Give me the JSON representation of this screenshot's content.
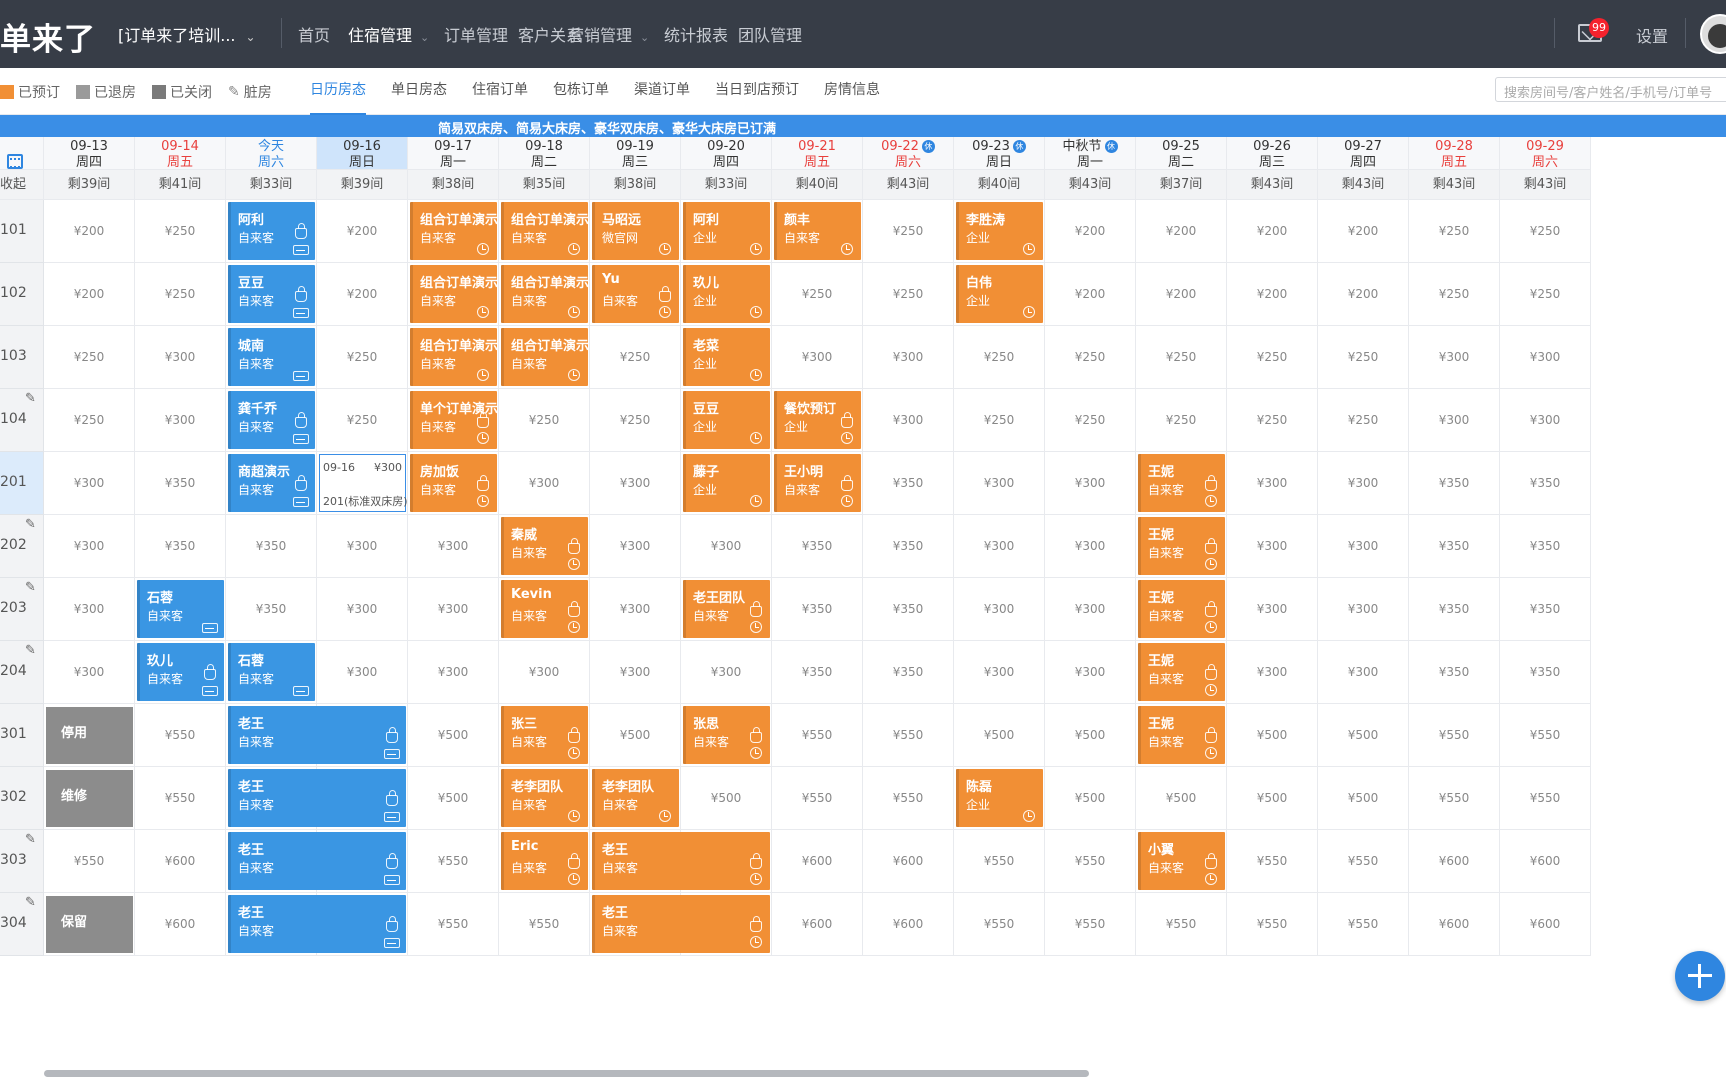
{
  "topbar": {
    "logo": "单来了",
    "store": "[订单来了培训...",
    "nav": [
      {
        "label": "首页",
        "active": false,
        "dropdown": false
      },
      {
        "label": "住宿管理",
        "active": true,
        "dropdown": true
      },
      {
        "label": "订单管理",
        "active": false,
        "dropdown": false
      },
      {
        "label": "客户关系",
        "active": false,
        "dropdown": false
      },
      {
        "label": "营销管理",
        "active": false,
        "dropdown": true
      },
      {
        "label": "统计报表",
        "active": false,
        "dropdown": false
      },
      {
        "label": "团队管理",
        "active": false,
        "dropdown": false
      }
    ],
    "mail_badge": "99",
    "settings": "设置"
  },
  "legend": [
    {
      "label": "已预订",
      "color": "#f18f35",
      "icon": "swatch"
    },
    {
      "label": "已退房",
      "color": "#9a9a9a",
      "icon": "swatch"
    },
    {
      "label": "已关闭",
      "color": "#7a7a7a",
      "icon": "swatch"
    },
    {
      "label": "脏房",
      "color": "",
      "icon": "broom-icon"
    }
  ],
  "tabs": [
    "日历房态",
    "单日房态",
    "住宿订单",
    "包栋订单",
    "渠道订单",
    "当日到店预订",
    "房情信息"
  ],
  "active_tab": 0,
  "search": {
    "placeholder": "搜索房间号/客户姓名/手机号/订单号"
  },
  "notice": "简易双床房、简易大床房、豪华双床房、豪华大床房已订满",
  "colors": {
    "booked": "#f18f35",
    "checked_in": "#3a96e3",
    "accent": "#2f86e0",
    "closed": "#8c8c8c"
  },
  "dates": [
    {
      "date": "09-13",
      "weekday": "周四",
      "type": "normal",
      "holiday": false
    },
    {
      "date": "09-14",
      "weekday": "周五",
      "type": "weekend",
      "holiday": false
    },
    {
      "date": "今天",
      "weekday": "周六",
      "type": "today",
      "holiday": false
    },
    {
      "date": "09-16",
      "weekday": "周日",
      "type": "selected",
      "holiday": false
    },
    {
      "date": "09-17",
      "weekday": "周一",
      "type": "normal",
      "holiday": false
    },
    {
      "date": "09-18",
      "weekday": "周二",
      "type": "normal",
      "holiday": false
    },
    {
      "date": "09-19",
      "weekday": "周三",
      "type": "normal",
      "holiday": false
    },
    {
      "date": "09-20",
      "weekday": "周四",
      "type": "normal",
      "holiday": false
    },
    {
      "date": "09-21",
      "weekday": "周五",
      "type": "weekend",
      "holiday": false
    },
    {
      "date": "09-22",
      "weekday": "周六",
      "type": "weekend",
      "holiday": true
    },
    {
      "date": "09-23",
      "weekday": "周日",
      "type": "normal",
      "holiday": true
    },
    {
      "date": "中秋节",
      "weekday": "周一",
      "type": "normal",
      "holiday": true
    },
    {
      "date": "09-25",
      "weekday": "周二",
      "type": "normal",
      "holiday": false
    },
    {
      "date": "09-26",
      "weekday": "周三",
      "type": "normal",
      "holiday": false
    },
    {
      "date": "09-27",
      "weekday": "周四",
      "type": "normal",
      "holiday": false
    },
    {
      "date": "09-28",
      "weekday": "周五",
      "type": "weekend",
      "holiday": false
    },
    {
      "date": "09-29",
      "weekday": "周六",
      "type": "weekend",
      "holiday": false
    }
  ],
  "holiday_badge": "休",
  "remaining_label": "收起",
  "remaining": [
    "剩39间",
    "剩41间",
    "剩33间",
    "剩39间",
    "剩38间",
    "剩35间",
    "剩38间",
    "剩33间",
    "剩40间",
    "剩43间",
    "剩40间",
    "剩43间",
    "剩37间",
    "剩43间",
    "剩43间",
    "剩43间",
    "剩43间"
  ],
  "rooms": [
    {
      "num": "101",
      "dirty": false,
      "prices": [
        "¥200",
        "¥250",
        "",
        "¥200",
        "",
        "",
        "",
        "",
        "",
        "¥250",
        "",
        "¥200",
        "¥200",
        "¥200",
        "¥200",
        "¥250",
        "¥250"
      ]
    },
    {
      "num": "102",
      "dirty": false,
      "prices": [
        "¥200",
        "¥250",
        "",
        "¥200",
        "",
        "",
        "",
        "",
        "¥250",
        "¥250",
        "",
        "¥200",
        "¥200",
        "¥200",
        "¥200",
        "¥250",
        "¥250"
      ]
    },
    {
      "num": "103",
      "dirty": false,
      "prices": [
        "¥250",
        "¥300",
        "",
        "¥250",
        "",
        "",
        "¥250",
        "",
        "¥300",
        "¥300",
        "¥250",
        "¥250",
        "¥250",
        "¥250",
        "¥250",
        "¥300",
        "¥300"
      ]
    },
    {
      "num": "104",
      "dirty": true,
      "prices": [
        "¥250",
        "¥300",
        "",
        "¥250",
        "",
        "¥250",
        "¥250",
        "",
        "",
        "¥300",
        "¥250",
        "¥250",
        "¥250",
        "¥250",
        "¥250",
        "¥300",
        "¥300"
      ]
    },
    {
      "num": "201",
      "dirty": false,
      "prices": [
        "¥300",
        "¥350",
        "",
        "",
        "",
        "¥300",
        "¥300",
        "",
        "",
        "¥350",
        "¥300",
        "¥300",
        "",
        "¥300",
        "¥300",
        "¥350",
        "¥350"
      ]
    },
    {
      "num": "202",
      "dirty": true,
      "prices": [
        "¥300",
        "¥350",
        "¥350",
        "¥300",
        "¥300",
        "",
        "¥300",
        "¥300",
        "¥350",
        "¥350",
        "¥300",
        "¥300",
        "",
        "¥300",
        "¥300",
        "¥350",
        "¥350"
      ]
    },
    {
      "num": "203",
      "dirty": true,
      "prices": [
        "¥300",
        "",
        "¥350",
        "¥300",
        "¥300",
        "",
        "¥300",
        "",
        "¥350",
        "¥350",
        "¥300",
        "¥300",
        "",
        "¥300",
        "¥300",
        "¥350",
        "¥350"
      ]
    },
    {
      "num": "204",
      "dirty": true,
      "prices": [
        "¥300",
        "",
        "",
        "¥300",
        "¥300",
        "¥300",
        "¥300",
        "¥300",
        "¥350",
        "¥350",
        "¥300",
        "¥300",
        "",
        "¥300",
        "¥300",
        "¥350",
        "¥350"
      ]
    },
    {
      "num": "301",
      "dirty": false,
      "prices": [
        "",
        "¥550",
        "",
        "",
        "¥500",
        "",
        "¥500",
        "",
        "¥550",
        "¥550",
        "¥500",
        "¥500",
        "",
        "¥500",
        "¥500",
        "¥550",
        "¥550"
      ]
    },
    {
      "num": "302",
      "dirty": false,
      "prices": [
        "",
        "¥550",
        "",
        "",
        "¥500",
        "",
        "",
        "¥500",
        "¥550",
        "¥550",
        "",
        "¥500",
        "¥500",
        "¥500",
        "¥500",
        "¥550",
        "¥550"
      ]
    },
    {
      "num": "303",
      "dirty": true,
      "prices": [
        "¥550",
        "¥600",
        "",
        "",
        "¥550",
        "",
        "",
        "",
        "¥600",
        "¥600",
        "¥550",
        "¥550",
        "",
        "¥550",
        "¥550",
        "¥600",
        "¥600"
      ]
    },
    {
      "num": "304",
      "dirty": true,
      "prices": [
        "",
        "¥600",
        "",
        "",
        "¥550",
        "¥550",
        "",
        "",
        "¥600",
        "¥600",
        "¥550",
        "¥550",
        "¥550",
        "¥550",
        "¥550",
        "¥600",
        "¥600"
      ]
    }
  ],
  "bookings": [
    {
      "room": 0,
      "col": 2,
      "span": 1,
      "name": "阿利",
      "source": "自来客",
      "color": "blue",
      "icons": [
        "lock",
        "bed"
      ]
    },
    {
      "room": 0,
      "col": 4,
      "span": 1,
      "name": "组合订单演示",
      "source": "自来客",
      "color": "orange",
      "icons": [
        "clock"
      ]
    },
    {
      "room": 0,
      "col": 5,
      "span": 1,
      "name": "组合订单演示",
      "source": "自来客",
      "color": "orange",
      "icons": [
        "clock"
      ]
    },
    {
      "room": 0,
      "col": 6,
      "span": 1,
      "name": "马昭远",
      "source": "微官网",
      "color": "orange",
      "icons": [
        "clock"
      ]
    },
    {
      "room": 0,
      "col": 7,
      "span": 1,
      "name": "阿利",
      "source": "企业",
      "color": "orange",
      "icons": [
        "clock"
      ]
    },
    {
      "room": 0,
      "col": 8,
      "span": 1,
      "name": "颜丰",
      "source": "自来客",
      "color": "orange",
      "icons": [
        "clock"
      ]
    },
    {
      "room": 0,
      "col": 10,
      "span": 1,
      "name": "李胜涛",
      "source": "企业",
      "color": "orange",
      "icons": [
        "clock"
      ]
    },
    {
      "room": 1,
      "col": 2,
      "span": 1,
      "name": "豆豆",
      "source": "自来客",
      "color": "blue",
      "icons": [
        "lock",
        "bed"
      ]
    },
    {
      "room": 1,
      "col": 4,
      "span": 1,
      "name": "组合订单演示",
      "source": "自来客",
      "color": "orange",
      "icons": [
        "clock"
      ]
    },
    {
      "room": 1,
      "col": 5,
      "span": 1,
      "name": "组合订单演示",
      "source": "自来客",
      "color": "orange",
      "icons": [
        "clock"
      ]
    },
    {
      "room": 1,
      "col": 6,
      "span": 1,
      "name": "Yu",
      "source": "自来客",
      "color": "orange",
      "icons": [
        "lock",
        "clock"
      ]
    },
    {
      "room": 1,
      "col": 7,
      "span": 1,
      "name": "玖儿",
      "source": "企业",
      "color": "orange",
      "icons": [
        "clock"
      ]
    },
    {
      "room": 1,
      "col": 10,
      "span": 1,
      "name": "白伟",
      "source": "企业",
      "color": "orange",
      "icons": [
        "clock"
      ]
    },
    {
      "room": 2,
      "col": 2,
      "span": 1,
      "name": "城南",
      "source": "自来客",
      "color": "blue",
      "icons": [
        "bed"
      ]
    },
    {
      "room": 2,
      "col": 4,
      "span": 1,
      "name": "组合订单演示",
      "source": "自来客",
      "color": "orange",
      "icons": [
        "clock"
      ]
    },
    {
      "room": 2,
      "col": 5,
      "span": 1,
      "name": "组合订单演示",
      "source": "自来客",
      "color": "orange",
      "icons": [
        "clock"
      ]
    },
    {
      "room": 2,
      "col": 7,
      "span": 1,
      "name": "老菜",
      "source": "企业",
      "color": "orange",
      "icons": [
        "clock"
      ]
    },
    {
      "room": 3,
      "col": 2,
      "span": 1,
      "name": "龚千乔",
      "source": "自来客",
      "color": "blue",
      "icons": [
        "lock",
        "bed"
      ]
    },
    {
      "room": 3,
      "col": 4,
      "span": 1,
      "name": "单个订单演示",
      "source": "自来客",
      "color": "orange",
      "icons": [
        "lock",
        "clock"
      ]
    },
    {
      "room": 3,
      "col": 7,
      "span": 1,
      "name": "豆豆",
      "source": "企业",
      "color": "orange",
      "icons": [
        "clock"
      ]
    },
    {
      "room": 3,
      "col": 8,
      "span": 1,
      "name": "餐饮预订",
      "source": "企业",
      "color": "orange",
      "icons": [
        "lock",
        "clock"
      ]
    },
    {
      "room": 4,
      "col": 2,
      "span": 1,
      "name": "商超演示",
      "source": "自来客",
      "color": "blue",
      "icons": [
        "lock",
        "bed"
      ]
    },
    {
      "room": 4,
      "col": 4,
      "span": 1,
      "name": "房加饭",
      "source": "自来客",
      "color": "orange",
      "icons": [
        "lock",
        "clock"
      ]
    },
    {
      "room": 4,
      "col": 7,
      "span": 1,
      "name": "藤子",
      "source": "企业",
      "color": "orange",
      "icons": [
        "clock"
      ]
    },
    {
      "room": 4,
      "col": 8,
      "span": 1,
      "name": "王小明",
      "source": "自来客",
      "color": "orange",
      "icons": [
        "lock",
        "clock"
      ]
    },
    {
      "room": 4,
      "col": 12,
      "span": 1,
      "name": "王妮",
      "source": "自来客",
      "color": "orange",
      "icons": [
        "lock",
        "clock"
      ]
    },
    {
      "room": 5,
      "col": 5,
      "span": 1,
      "name": "秦威",
      "source": "自来客",
      "color": "orange",
      "icons": [
        "lock",
        "clock"
      ]
    },
    {
      "room": 5,
      "col": 12,
      "span": 1,
      "name": "王妮",
      "source": "自来客",
      "color": "orange",
      "icons": [
        "lock",
        "clock"
      ]
    },
    {
      "room": 6,
      "col": 1,
      "span": 1,
      "name": "石蓉",
      "source": "自来客",
      "color": "blue",
      "icons": [
        "bed"
      ]
    },
    {
      "room": 6,
      "col": 5,
      "span": 1,
      "name": "Kevin",
      "source": "自来客",
      "color": "orange",
      "icons": [
        "lock",
        "clock"
      ]
    },
    {
      "room": 6,
      "col": 7,
      "span": 1,
      "name": "老王团队",
      "source": "自来客",
      "color": "orange",
      "icons": [
        "lock",
        "clock"
      ]
    },
    {
      "room": 6,
      "col": 12,
      "span": 1,
      "name": "王妮",
      "source": "自来客",
      "color": "orange",
      "icons": [
        "lock",
        "clock"
      ]
    },
    {
      "room": 7,
      "col": 1,
      "span": 1,
      "name": "玖儿",
      "source": "自来客",
      "color": "blue",
      "icons": [
        "lock",
        "bed"
      ]
    },
    {
      "room": 7,
      "col": 2,
      "span": 1,
      "name": "石蓉",
      "source": "自来客",
      "color": "blue",
      "icons": [
        "bed"
      ]
    },
    {
      "room": 7,
      "col": 12,
      "span": 1,
      "name": "王妮",
      "source": "自来客",
      "color": "orange",
      "icons": [
        "lock",
        "clock"
      ]
    },
    {
      "room": 8,
      "col": 2,
      "span": 2,
      "name": "老王",
      "source": "自来客",
      "color": "blue",
      "icons": [
        "lock",
        "bed"
      ]
    },
    {
      "room": 8,
      "col": 5,
      "span": 1,
      "name": "张三",
      "source": "自来客",
      "color": "orange",
      "icons": [
        "lock",
        "clock"
      ]
    },
    {
      "room": 8,
      "col": 7,
      "span": 1,
      "name": "张思",
      "source": "自来客",
      "color": "orange",
      "icons": [
        "lock",
        "clock"
      ]
    },
    {
      "room": 8,
      "col": 12,
      "span": 1,
      "name": "王妮",
      "source": "自来客",
      "color": "orange",
      "icons": [
        "lock",
        "clock"
      ]
    },
    {
      "room": 9,
      "col": 2,
      "span": 2,
      "name": "老王",
      "source": "自来客",
      "color": "blue",
      "icons": [
        "lock",
        "bed"
      ]
    },
    {
      "room": 9,
      "col": 5,
      "span": 1,
      "name": "老李团队",
      "source": "自来客",
      "color": "orange",
      "icons": [
        "clock"
      ]
    },
    {
      "room": 9,
      "col": 6,
      "span": 1,
      "name": "老李团队",
      "source": "自来客",
      "color": "orange",
      "icons": [
        "clock"
      ]
    },
    {
      "room": 9,
      "col": 10,
      "span": 1,
      "name": "陈磊",
      "source": "企业",
      "color": "orange",
      "icons": [
        "clock"
      ]
    },
    {
      "room": 10,
      "col": 2,
      "span": 2,
      "name": "老王",
      "source": "自来客",
      "color": "blue",
      "icons": [
        "lock",
        "bed"
      ]
    },
    {
      "room": 10,
      "col": 5,
      "span": 1,
      "name": "Eric",
      "source": "自来客",
      "color": "orange",
      "icons": [
        "lock",
        "clock"
      ]
    },
    {
      "room": 10,
      "col": 6,
      "span": 2,
      "name": "老王",
      "source": "自来客",
      "color": "orange",
      "icons": [
        "lock",
        "clock"
      ]
    },
    {
      "room": 10,
      "col": 12,
      "span": 1,
      "name": "小翼",
      "source": "自来客",
      "color": "orange",
      "icons": [
        "lock",
        "clock"
      ]
    },
    {
      "room": 11,
      "col": 2,
      "span": 2,
      "name": "老王",
      "source": "自来客",
      "color": "blue",
      "icons": [
        "lock",
        "bed"
      ]
    },
    {
      "room": 11,
      "col": 6,
      "span": 2,
      "name": "老王",
      "source": "自来客",
      "color": "orange",
      "icons": [
        "lock",
        "clock"
      ]
    }
  ],
  "status_blocks": [
    {
      "room": 8,
      "col": 0,
      "label": "停用"
    },
    {
      "room": 9,
      "col": 0,
      "label": "维修"
    },
    {
      "room": 11,
      "col": 0,
      "label": "保留"
    }
  ],
  "selection": {
    "room": 4,
    "col": 3,
    "date": "09-16",
    "price": "¥300",
    "text": "201(标准双床房)"
  }
}
